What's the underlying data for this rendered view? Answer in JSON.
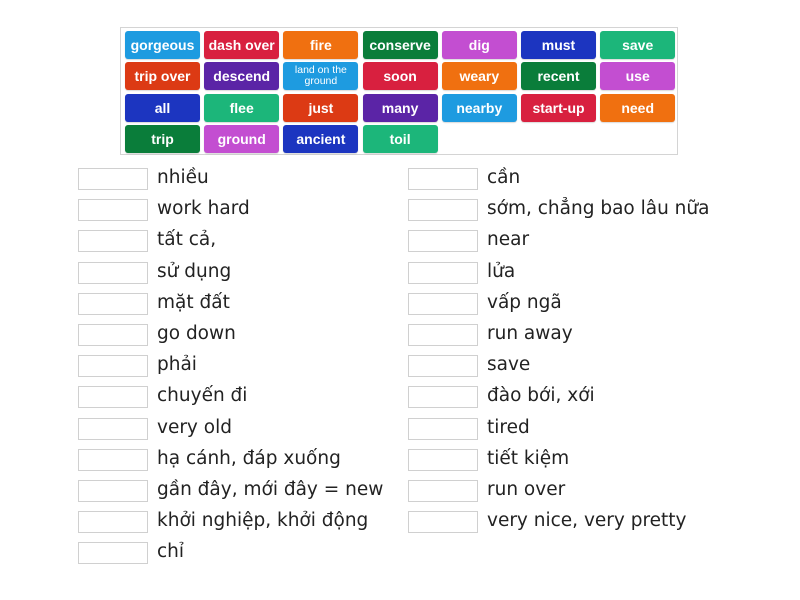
{
  "word_bank": [
    {
      "label": "gorgeous",
      "color": "#1e9be0"
    },
    {
      "label": "dash over",
      "color": "#d8203f"
    },
    {
      "label": "fire",
      "color": "#f07010"
    },
    {
      "label": "conserve",
      "color": "#0a7d3a"
    },
    {
      "label": "dig",
      "color": "#c34ed1"
    },
    {
      "label": "must",
      "color": "#1c35c0"
    },
    {
      "label": "save",
      "color": "#1cb67a"
    },
    {
      "label": "trip over",
      "color": "#dc3a14"
    },
    {
      "label": "descend",
      "color": "#5b24a6"
    },
    {
      "label": "land on the ground",
      "color": "#1e9be0",
      "small": true
    },
    {
      "label": "soon",
      "color": "#d8203f"
    },
    {
      "label": "weary",
      "color": "#f07010"
    },
    {
      "label": "recent",
      "color": "#0a7d3a"
    },
    {
      "label": "use",
      "color": "#c34ed1"
    },
    {
      "label": "all",
      "color": "#1c35c0"
    },
    {
      "label": "flee",
      "color": "#1cb67a"
    },
    {
      "label": "just",
      "color": "#dc3a14"
    },
    {
      "label": "many",
      "color": "#5b24a6"
    },
    {
      "label": "nearby",
      "color": "#1e9be0"
    },
    {
      "label": "start-up",
      "color": "#d8203f"
    },
    {
      "label": "need",
      "color": "#f07010"
    },
    {
      "label": "trip",
      "color": "#0a7d3a"
    },
    {
      "label": "ground",
      "color": "#c34ed1"
    },
    {
      "label": "ancient",
      "color": "#1c35c0"
    },
    {
      "label": "toil",
      "color": "#1cb67a"
    }
  ],
  "left_clues": [
    "nhiều",
    "work hard",
    "tất cả,",
    "sử dụng",
    "mặt đất",
    "go down",
    "phải",
    "chuyến đi",
    "very old",
    "hạ cánh, đáp xuống",
    "gần đây, mới đây = new",
    "khởi nghiệp, khởi động",
    "chỉ"
  ],
  "right_clues": [
    "cần",
    "sớm, chẳng bao lâu nữa",
    "near",
    "lửa",
    "vấp ngã",
    "run away",
    "save",
    "đào bới, xới",
    "tired",
    "tiết kiệm",
    "run over",
    "very nice, very pretty"
  ]
}
